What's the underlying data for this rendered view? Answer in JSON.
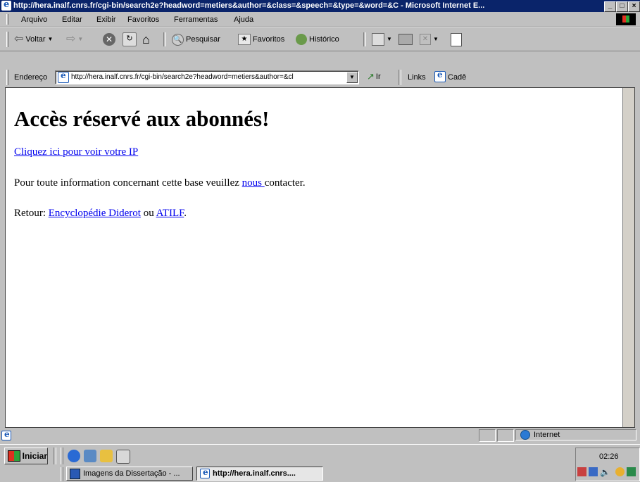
{
  "window": {
    "title": "http://hera.inalf.cnrs.fr/cgi-bin/search2e?headword=metiers&author=&class=&speech=&type=&word=&C - Microsoft Internet E...",
    "controls": [
      "_",
      "□",
      "×"
    ]
  },
  "menu": [
    "Arquivo",
    "Editar",
    "Exibir",
    "Favoritos",
    "Ferramentas",
    "Ajuda"
  ],
  "toolbar": {
    "back": "Voltar",
    "search": "Pesquisar",
    "favorites": "Favoritos",
    "history": "Histórico"
  },
  "address": {
    "label": "Endereço",
    "url": "http://hera.inalf.cnrs.fr/cgi-bin/search2e?headword=metiers&author=&cl",
    "go": "Ir",
    "links_label": "Links",
    "links_item": "Cadê"
  },
  "page": {
    "heading": "Accès réservé aux abonnés!",
    "ip_link": "Cliquez ici pour voir votre IP",
    "info_before": "Pour toute information concernant cette base veuillez",
    "info_link": "nous ",
    "info_after": "contacter.",
    "return_label": "Retour:",
    "return_link1": "Encyclopédie Diderot",
    "return_or": "ou",
    "return_link2": "ATILF",
    "return_end": "."
  },
  "status": {
    "zone": "Internet"
  },
  "taskbar": {
    "start": "Iniciar",
    "tasks": [
      {
        "label": "Imagens da Dissertação - ..."
      },
      {
        "label": "http://hera.inalf.cnrs...."
      }
    ],
    "clock": "02:26"
  },
  "colors": {
    "titlebar": "#0a246a",
    "link": "#0000ee",
    "chrome": "#c0c0c0"
  }
}
